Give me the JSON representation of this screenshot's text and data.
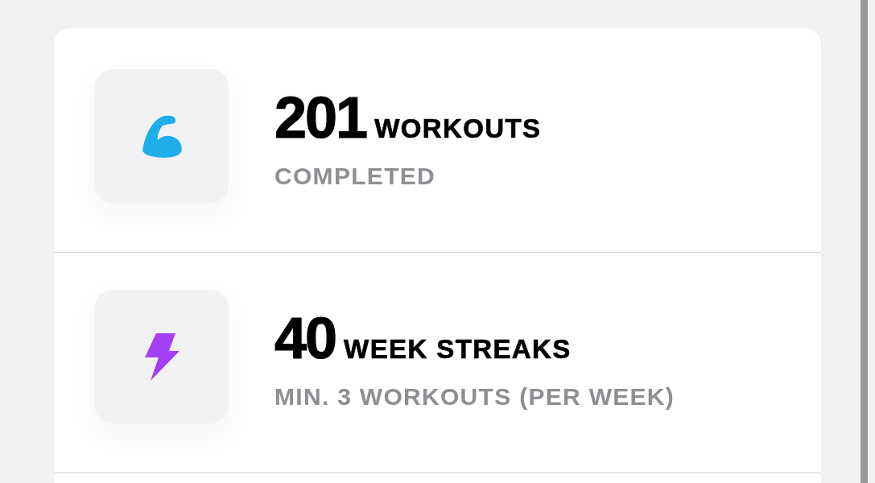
{
  "stats": [
    {
      "kind": "strength",
      "color": "#1eaeea",
      "value": "201",
      "unit": "WORKOUTS",
      "caption": "COMPLETED"
    },
    {
      "kind": "streak",
      "color": "#a33ff5",
      "value": "40",
      "unit": "WEEK STREAKS",
      "caption": "MIN. 3 WORKOUTS (PER WEEK)"
    }
  ]
}
